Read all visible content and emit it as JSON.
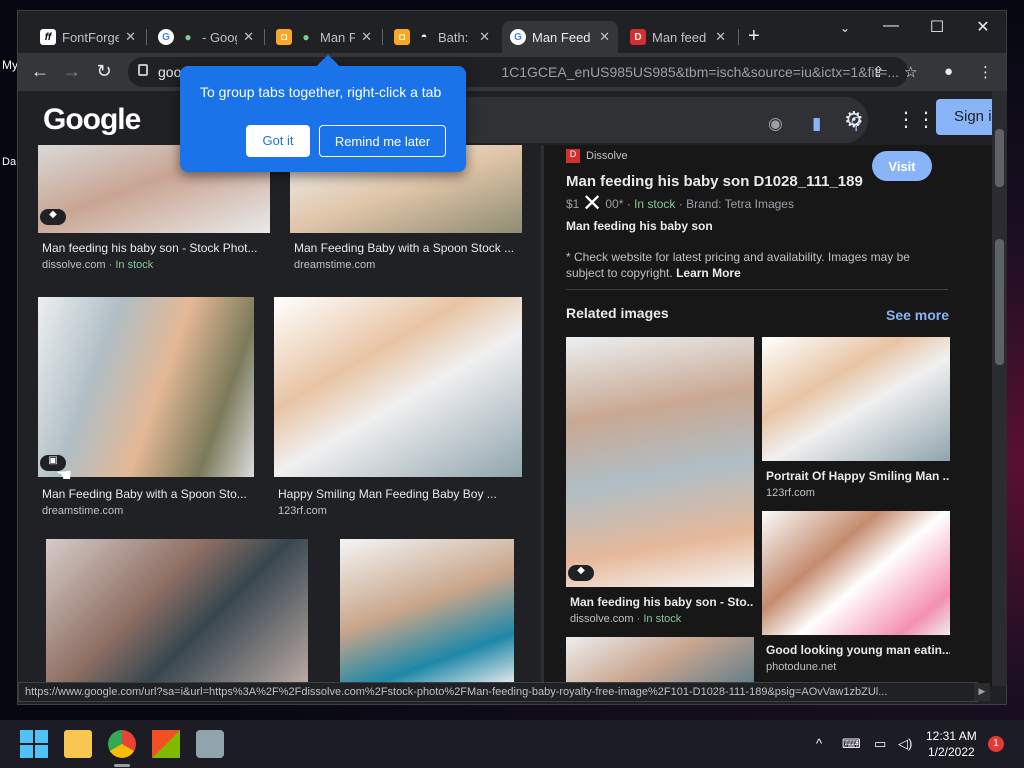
{
  "desktop": {
    "frag_my": "My",
    "frag_da": "Da"
  },
  "tabs": [
    {
      "title": "FontForge",
      "fav": "ff",
      "fav_color": "#ffffff"
    },
    {
      "title": "- Goog",
      "fav": "G",
      "fav_color": "#ffffff"
    },
    {
      "title": "Man F",
      "fav": "●",
      "fav_color": "#f9a825"
    },
    {
      "title": "Bath: ",
      "fav": "●",
      "fav_color": "#f9a825"
    },
    {
      "title": "Man Feed",
      "fav": "G",
      "fav_color": "#ffffff"
    },
    {
      "title": "Man feed",
      "fav": "D",
      "fav_color": "#d32f2f"
    }
  ],
  "toolbar": {
    "url_host": "goo",
    "url_rest": "1C1GCEA_enUS985US985&tbm=isch&source=iu&ictx=1&fir=..."
  },
  "callout": {
    "message": "To group tabs together, right-click a tab",
    "got_it": "Got it",
    "remind": "Remind me later"
  },
  "header": {
    "logo": "Google",
    "signin": "Sign i"
  },
  "results": [
    {
      "caption": "Man feeding his baby son - Stock Phot...",
      "source": "dissolve.com",
      "stock": " · In stock"
    },
    {
      "caption": "Man Feeding Baby with a Spoon Stock ...",
      "source": "dreamstime.com",
      "stock": ""
    },
    {
      "caption": "Man Feeding Baby with a Spoon Sto...",
      "source": "dreamstime.com",
      "stock": ""
    },
    {
      "caption": "Happy Smiling Man Feeding Baby Boy ...",
      "source": "123rf.com",
      "stock": ""
    }
  ],
  "panel": {
    "source": "Dissolve",
    "title": "Man feeding his baby son D1028_111_189",
    "visit": "Visit",
    "price": "$1",
    "price_tail": "00*",
    "in_stock": "In stock",
    "brand": "Brand: Tetra Images",
    "desc": "Man feeding his baby son",
    "note": "* Check website for latest pricing and availability. Images may be subject to copyright.",
    "learn_more": "Learn More",
    "related_title": "Related images",
    "see_more": "See more",
    "related": [
      {
        "caption": "Man feeding his baby son - Sto...",
        "source": "dissolve.com",
        "stock": " · In stock"
      },
      {
        "caption": "Portrait Of Happy Smiling Man ...",
        "source": "123rf.com",
        "stock": ""
      },
      {
        "caption": "Good looking young man eatin...",
        "source": "photodune.net",
        "stock": ""
      }
    ]
  },
  "status_url": "https://www.google.com/url?sa=i&url=https%3A%2F%2Fdissolve.com%2Fstock-photo%2FMan-feeding-baby-royalty-free-image%2F101-D1028-111-189&psig=AOvVaw1zbZUl...",
  "clock": {
    "time": "12:31 AM",
    "date": "1/2/2022"
  },
  "notification_count": "1"
}
